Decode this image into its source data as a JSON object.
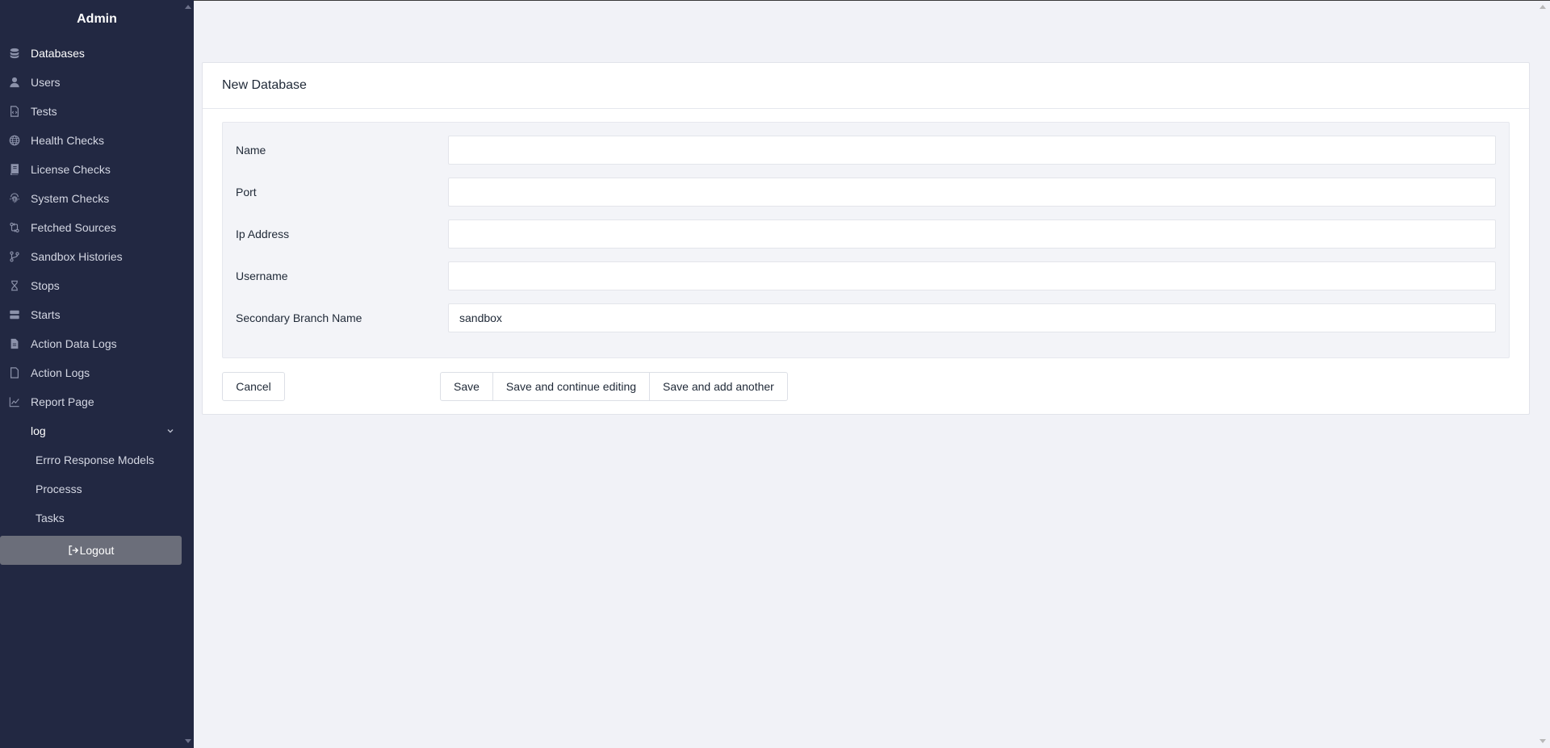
{
  "sidebar": {
    "title": "Admin",
    "items": [
      {
        "label": "Databases",
        "icon": "database-icon"
      },
      {
        "label": "Users",
        "icon": "user-icon"
      },
      {
        "label": "Tests",
        "icon": "file-code-icon"
      },
      {
        "label": "Health Checks",
        "icon": "globe-icon"
      },
      {
        "label": "License Checks",
        "icon": "book-icon"
      },
      {
        "label": "System Checks",
        "icon": "fingerprint-icon"
      },
      {
        "label": "Fetched Sources",
        "icon": "code-compare-icon"
      },
      {
        "label": "Sandbox Histories",
        "icon": "code-branch-icon"
      },
      {
        "label": "Stops",
        "icon": "hourglass-icon"
      },
      {
        "label": "Starts",
        "icon": "server-icon"
      },
      {
        "label": "Action Data Logs",
        "icon": "file-lines-icon"
      },
      {
        "label": "Action Logs",
        "icon": "file-icon"
      },
      {
        "label": "Report Page",
        "icon": "chart-line-icon"
      }
    ],
    "group": {
      "label": "log",
      "icon": "chevron-down-icon",
      "items": [
        {
          "label": "Errro Response Models"
        },
        {
          "label": "Processs"
        },
        {
          "label": "Tasks"
        }
      ]
    },
    "logout_label": "Logout"
  },
  "form": {
    "title": "New Database",
    "fields": [
      {
        "label": "Name",
        "value": ""
      },
      {
        "label": "Port",
        "value": ""
      },
      {
        "label": "Ip Address",
        "value": ""
      },
      {
        "label": "Username",
        "value": ""
      },
      {
        "label": "Secondary Branch Name",
        "value": "sandbox"
      }
    ],
    "buttons": {
      "cancel": "Cancel",
      "save": "Save",
      "save_continue": "Save and continue editing",
      "save_add": "Save and add another"
    }
  },
  "colors": {
    "sidebar_bg": "#222842",
    "page_bg": "#f1f2f7",
    "logout_bg": "#6b6e7a"
  }
}
